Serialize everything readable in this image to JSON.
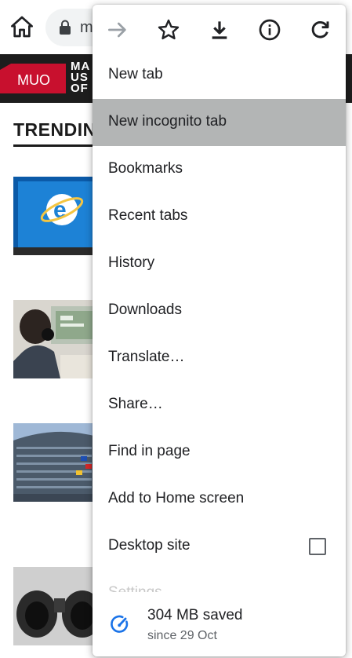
{
  "background": {
    "url_fragment": "m",
    "site_logo": "MUO",
    "site_name_lines": [
      "MA",
      "US",
      "OF"
    ],
    "section_heading": "TRENDIN"
  },
  "menu": {
    "top_icons": [
      "forward-icon",
      "star-icon",
      "download-icon",
      "info-icon",
      "refresh-icon"
    ],
    "items": [
      {
        "label": "New tab"
      },
      {
        "label": "New incognito tab"
      },
      {
        "label": "Bookmarks"
      },
      {
        "label": "Recent tabs"
      },
      {
        "label": "History"
      },
      {
        "label": "Downloads"
      },
      {
        "label": "Translate…"
      },
      {
        "label": "Share…"
      },
      {
        "label": "Find in page"
      },
      {
        "label": "Add to Home screen"
      },
      {
        "label": "Desktop site"
      }
    ],
    "partially_visible_item": "Settings",
    "data_saver": {
      "main": "304 MB saved",
      "sub": "since 29 Oct"
    }
  },
  "colors": {
    "highlight": "#b3b5b5",
    "accent_blue": "#1a73e8",
    "brand_red": "#c8102e"
  }
}
